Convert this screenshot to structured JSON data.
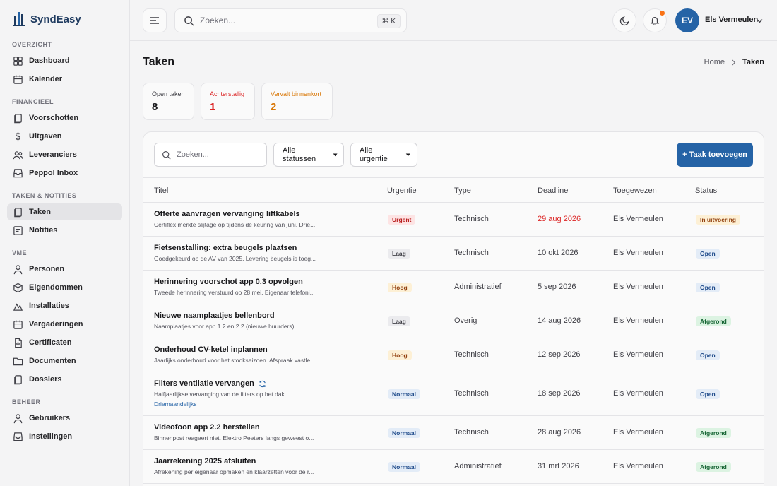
{
  "app": {
    "name": "SyndEasy"
  },
  "sidebar": {
    "sections": [
      {
        "title": "OVERZICHT",
        "items": [
          {
            "label": "Dashboard",
            "icon": "grid-icon"
          },
          {
            "label": "Kalender",
            "icon": "calendar-icon"
          }
        ]
      },
      {
        "title": "FINANCIEEL",
        "items": [
          {
            "label": "Voorschotten",
            "icon": "copy-icon"
          },
          {
            "label": "Uitgaven",
            "icon": "dollar-icon"
          },
          {
            "label": "Leveranciers",
            "icon": "users-icon"
          },
          {
            "label": "Peppol Inbox",
            "icon": "inbox-icon"
          }
        ]
      },
      {
        "title": "TAKEN & NOTITIES",
        "items": [
          {
            "label": "Taken",
            "icon": "copy-icon",
            "active": true
          },
          {
            "label": "Notities",
            "icon": "note-icon"
          }
        ]
      },
      {
        "title": "VME",
        "items": [
          {
            "label": "Personen",
            "icon": "person-icon"
          },
          {
            "label": "Eigendommen",
            "icon": "box-icon"
          },
          {
            "label": "Installaties",
            "icon": "tool-icon"
          },
          {
            "label": "Vergaderingen",
            "icon": "calendar-icon"
          },
          {
            "label": "Certificaten",
            "icon": "certificate-icon"
          },
          {
            "label": "Documenten",
            "icon": "folder-icon"
          },
          {
            "label": "Dossiers",
            "icon": "file-icon"
          }
        ]
      },
      {
        "title": "BEHEER",
        "items": [
          {
            "label": "Gebruikers",
            "icon": "person-icon"
          },
          {
            "label": "Instellingen",
            "icon": "inbox-icon"
          }
        ]
      }
    ]
  },
  "topbar": {
    "search_placeholder": "Zoeken...",
    "shortcut": "⌘ K",
    "user_initials": "EV",
    "user_name": "Els Vermeulen"
  },
  "page": {
    "title": "Taken",
    "breadcrumb": {
      "home": "Home",
      "current": "Taken"
    }
  },
  "stats": [
    {
      "label": "Open taken",
      "value": "8",
      "color": "#18181b"
    },
    {
      "label": "Achterstallig",
      "value": "1",
      "color": "#dc2626"
    },
    {
      "label": "Vervalt binnenkort",
      "value": "2",
      "color": "#d97706"
    }
  ],
  "filters": {
    "search_placeholder": "Zoeken...",
    "status": "Alle statussen",
    "urgency": "Alle urgentie",
    "add_button": "+ Taak toevoegen"
  },
  "table": {
    "headers": [
      "Titel",
      "Urgentie",
      "Type",
      "Deadline",
      "Toegewezen",
      "Status"
    ],
    "rows": [
      {
        "title": "Offerte aanvragen vervanging liftkabels",
        "desc": "Certiflex merkte slijtage op tijdens de keuring van juni. Drie...",
        "urgency": "Urgent",
        "type": "Technisch",
        "deadline": "29 aug 2026",
        "overdue": true,
        "assignee": "Els Vermeulen",
        "status": "In uitvoering"
      },
      {
        "title": "Fietsenstalling: extra beugels plaatsen",
        "desc": "Goedgekeurd op de AV van 2025. Levering beugels is toeg...",
        "urgency": "Laag",
        "type": "Technisch",
        "deadline": "10 okt 2026",
        "assignee": "Els Vermeulen",
        "status": "Open"
      },
      {
        "title": "Herinnering voorschot app 0.3 opvolgen",
        "desc": "Tweede herinnering verstuurd op 28 mei. Eigenaar telefoni...",
        "urgency": "Hoog",
        "type": "Administratief",
        "deadline": "5 sep 2026",
        "assignee": "Els Vermeulen",
        "status": "Open"
      },
      {
        "title": "Nieuwe naamplaatjes bellenbord",
        "desc": "Naamplaatjes voor app 1.2 en 2.2 (nieuwe huurders).",
        "urgency": "Laag",
        "type": "Overig",
        "deadline": "14 aug 2026",
        "assignee": "Els Vermeulen",
        "status": "Afgerond"
      },
      {
        "title": "Onderhoud CV-ketel inplannen",
        "desc": "Jaarlijks onderhoud voor het stookseizoen. Afspraak vastle...",
        "urgency": "Hoog",
        "type": "Technisch",
        "deadline": "12 sep 2026",
        "assignee": "Els Vermeulen",
        "status": "Open"
      },
      {
        "title": "Filters ventilatie vervangen",
        "desc": "Halfjaarlijkse vervanging van de filters op het dak.",
        "recurrence": "Driemaandelijks",
        "urgency": "Normaal",
        "type": "Technisch",
        "deadline": "18 sep 2026",
        "assignee": "Els Vermeulen",
        "status": "Open"
      },
      {
        "title": "Videofoon app 2.2 herstellen",
        "desc": "Binnenpost reageert niet. Elektro Peeters langs geweest o...",
        "urgency": "Normaal",
        "type": "Technisch",
        "deadline": "28 aug 2026",
        "assignee": "Els Vermeulen",
        "status": "Afgerond"
      },
      {
        "title": "Jaarrekening 2025 afsluiten",
        "desc": "Afrekening per eigenaar opmaken en klaarzetten voor de r...",
        "urgency": "Normaal",
        "type": "Administratief",
        "deadline": "31 mrt 2026",
        "assignee": "Els Vermeulen",
        "status": "Afgerond"
      }
    ]
  }
}
